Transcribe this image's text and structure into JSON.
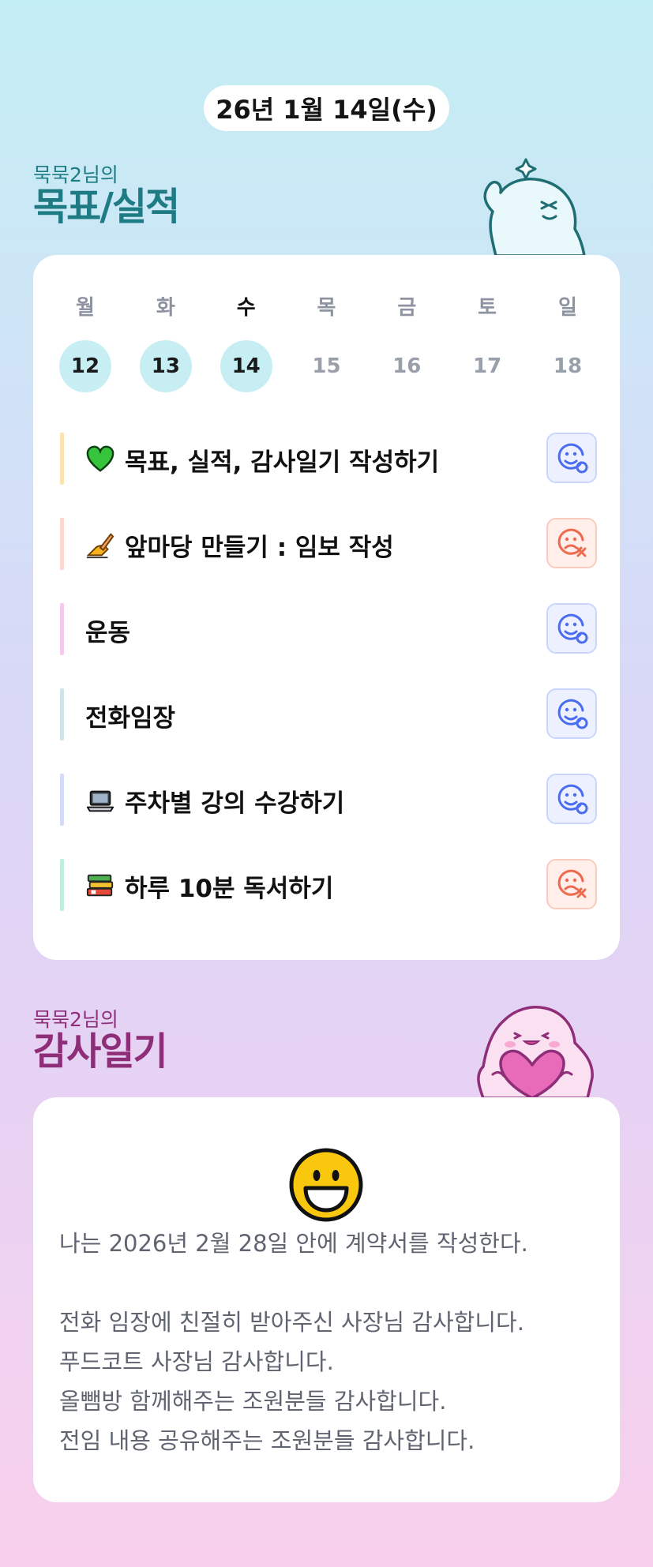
{
  "header": {
    "date": "26년 1월 14일(수)"
  },
  "goals_section": {
    "owner": "묵묵2님의",
    "title": "목표/실적"
  },
  "calendar": {
    "weekdays": [
      "월",
      "화",
      "수",
      "목",
      "금",
      "토",
      "일"
    ],
    "days": [
      "12",
      "13",
      "14",
      "15",
      "16",
      "17",
      "18"
    ],
    "done_days": [
      "12",
      "13",
      "14"
    ],
    "today": "수"
  },
  "goals": [
    {
      "icon": "green-heart-icon",
      "label": "목표, 실적, 감사일기 작성하기",
      "bar_color": "#fbe3ad",
      "status": "done"
    },
    {
      "icon": "writing-hand-icon",
      "label": "앞마당 만들기 : 임보 작성",
      "bar_color": "#fcd8d1",
      "status": "not-done"
    },
    {
      "icon": "",
      "label": "운동",
      "bar_color": "#f5c9ec",
      "status": "done"
    },
    {
      "icon": "",
      "label": "전화임장",
      "bar_color": "#cfe4e6",
      "status": "done"
    },
    {
      "icon": "laptop-icon",
      "label": "주차별 강의 수강하기",
      "bar_color": "#d4dbf7",
      "status": "done"
    },
    {
      "icon": "books-icon",
      "label": "하루 10분 독서하기",
      "bar_color": "#bfeede",
      "status": "not-done"
    }
  ],
  "thanks_section": {
    "owner": "묵묵2님의",
    "title": "감사일기"
  },
  "thanks_diary": {
    "mood_icon": "grinning-face-icon",
    "lines": [
      "나는 2026년 2월 28일 안에 계약서를 작성한다.",
      "",
      "전화 임장에 친절히 받아주신 사장님 감사합니다.",
      "푸드코트 사장님 감사합니다.",
      "올뺌방 함께해주는 조원분들 감사합니다.",
      "전임 내용 공유해주는 조원분들 감사합니다."
    ]
  },
  "colors": {
    "goal_title": "#1e7b83",
    "thanks_title": "#8f2e78",
    "done_status": "#4a6cf0",
    "fail_status": "#ee6a4f",
    "day_done_bg": "#c6eef3"
  }
}
